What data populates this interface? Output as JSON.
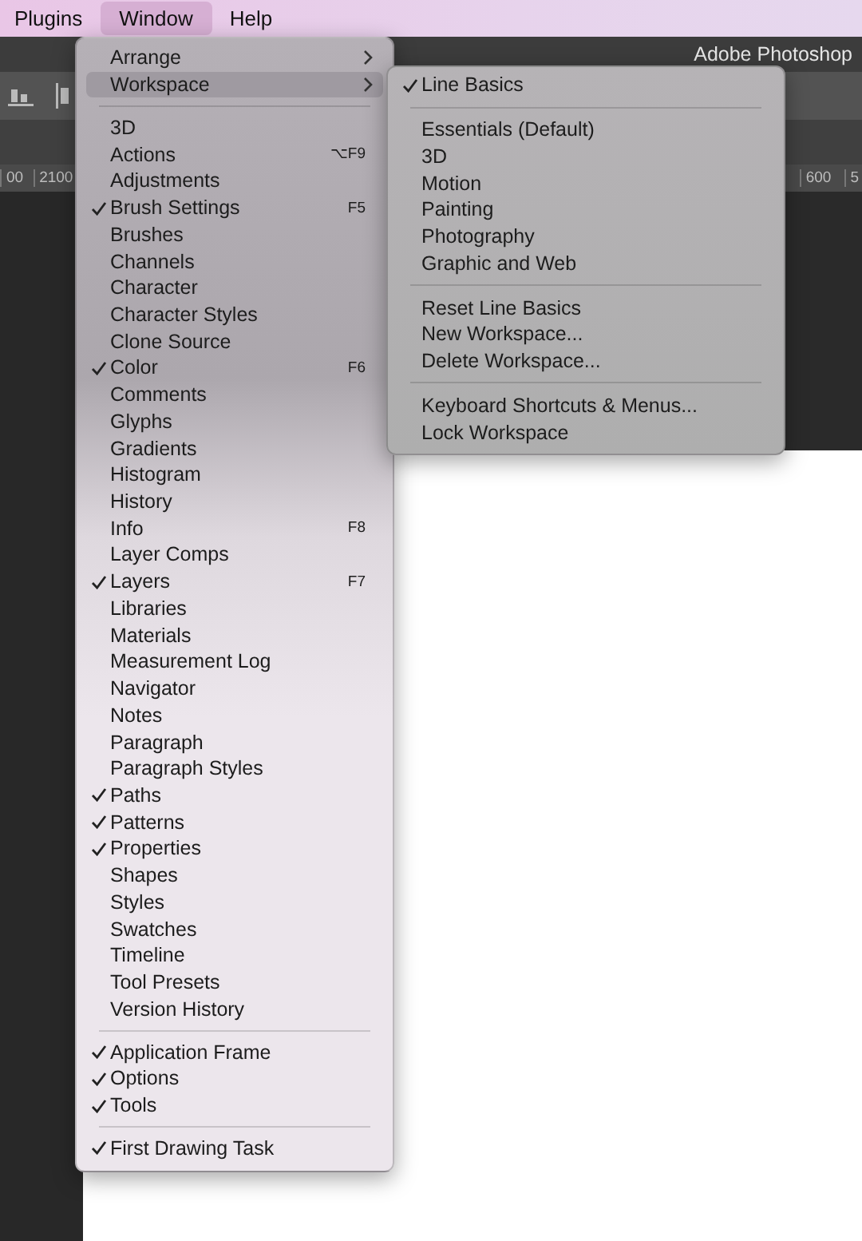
{
  "menu_bar": [
    {
      "label": "Plugins",
      "selected": false
    },
    {
      "label": "Window",
      "selected": true
    },
    {
      "label": "Help",
      "selected": false
    }
  ],
  "app_title": "Adobe Photoshop",
  "ruler": {
    "left_labels": [
      "00",
      "2100"
    ],
    "right_labels": [
      "600",
      "5"
    ]
  },
  "window_menu": {
    "items": [
      {
        "kind": "item",
        "label": "Arrange",
        "checked": false,
        "selected": false,
        "submenu": true
      },
      {
        "kind": "item",
        "label": "Workspace",
        "checked": false,
        "selected": true,
        "submenu": true
      },
      {
        "kind": "separator"
      },
      {
        "kind": "item",
        "label": "3D",
        "checked": false,
        "selected": false,
        "submenu": false
      },
      {
        "kind": "item",
        "label": "Actions",
        "checked": false,
        "selected": false,
        "submenu": false,
        "shortcut": "⌥F9"
      },
      {
        "kind": "item",
        "label": "Adjustments",
        "checked": false,
        "selected": false,
        "submenu": false
      },
      {
        "kind": "item",
        "label": "Brush Settings",
        "checked": true,
        "selected": false,
        "submenu": false,
        "shortcut": "F5"
      },
      {
        "kind": "item",
        "label": "Brushes",
        "checked": false,
        "selected": false,
        "submenu": false
      },
      {
        "kind": "item",
        "label": "Channels",
        "checked": false,
        "selected": false,
        "submenu": false
      },
      {
        "kind": "item",
        "label": "Character",
        "checked": false,
        "selected": false,
        "submenu": false
      },
      {
        "kind": "item",
        "label": "Character Styles",
        "checked": false,
        "selected": false,
        "submenu": false
      },
      {
        "kind": "item",
        "label": "Clone Source",
        "checked": false,
        "selected": false,
        "submenu": false
      },
      {
        "kind": "item",
        "label": "Color",
        "checked": true,
        "selected": false,
        "submenu": false,
        "shortcut": "F6"
      },
      {
        "kind": "item",
        "label": "Comments",
        "checked": false,
        "selected": false,
        "submenu": false
      },
      {
        "kind": "item",
        "label": "Glyphs",
        "checked": false,
        "selected": false,
        "submenu": false
      },
      {
        "kind": "item",
        "label": "Gradients",
        "checked": false,
        "selected": false,
        "submenu": false
      },
      {
        "kind": "item",
        "label": "Histogram",
        "checked": false,
        "selected": false,
        "submenu": false
      },
      {
        "kind": "item",
        "label": "History",
        "checked": false,
        "selected": false,
        "submenu": false
      },
      {
        "kind": "item",
        "label": "Info",
        "checked": false,
        "selected": false,
        "submenu": false,
        "shortcut": "F8"
      },
      {
        "kind": "item",
        "label": "Layer Comps",
        "checked": false,
        "selected": false,
        "submenu": false
      },
      {
        "kind": "item",
        "label": "Layers",
        "checked": true,
        "selected": false,
        "submenu": false,
        "shortcut": "F7"
      },
      {
        "kind": "item",
        "label": "Libraries",
        "checked": false,
        "selected": false,
        "submenu": false
      },
      {
        "kind": "item",
        "label": "Materials",
        "checked": false,
        "selected": false,
        "submenu": false
      },
      {
        "kind": "item",
        "label": "Measurement Log",
        "checked": false,
        "selected": false,
        "submenu": false
      },
      {
        "kind": "item",
        "label": "Navigator",
        "checked": false,
        "selected": false,
        "submenu": false
      },
      {
        "kind": "item",
        "label": "Notes",
        "checked": false,
        "selected": false,
        "submenu": false
      },
      {
        "kind": "item",
        "label": "Paragraph",
        "checked": false,
        "selected": false,
        "submenu": false
      },
      {
        "kind": "item",
        "label": "Paragraph Styles",
        "checked": false,
        "selected": false,
        "submenu": false
      },
      {
        "kind": "item",
        "label": "Paths",
        "checked": true,
        "selected": false,
        "submenu": false
      },
      {
        "kind": "item",
        "label": "Patterns",
        "checked": true,
        "selected": false,
        "submenu": false
      },
      {
        "kind": "item",
        "label": "Properties",
        "checked": true,
        "selected": false,
        "submenu": false
      },
      {
        "kind": "item",
        "label": "Shapes",
        "checked": false,
        "selected": false,
        "submenu": false
      },
      {
        "kind": "item",
        "label": "Styles",
        "checked": false,
        "selected": false,
        "submenu": false
      },
      {
        "kind": "item",
        "label": "Swatches",
        "checked": false,
        "selected": false,
        "submenu": false
      },
      {
        "kind": "item",
        "label": "Timeline",
        "checked": false,
        "selected": false,
        "submenu": false
      },
      {
        "kind": "item",
        "label": "Tool Presets",
        "checked": false,
        "selected": false,
        "submenu": false
      },
      {
        "kind": "item",
        "label": "Version History",
        "checked": false,
        "selected": false,
        "submenu": false
      },
      {
        "kind": "separator"
      },
      {
        "kind": "item",
        "label": "Application Frame",
        "checked": true,
        "selected": false,
        "submenu": false
      },
      {
        "kind": "item",
        "label": "Options",
        "checked": true,
        "selected": false,
        "submenu": false
      },
      {
        "kind": "item",
        "label": "Tools",
        "checked": true,
        "selected": false,
        "submenu": false
      },
      {
        "kind": "separator"
      },
      {
        "kind": "item",
        "label": "First  Drawing Task",
        "checked": true,
        "selected": false,
        "submenu": false
      }
    ]
  },
  "workspace_submenu": {
    "items": [
      {
        "kind": "item",
        "label": "Line Basics",
        "checked": true
      },
      {
        "kind": "separator"
      },
      {
        "kind": "item",
        "label": "Essentials (Default)",
        "checked": false
      },
      {
        "kind": "item",
        "label": "3D",
        "checked": false
      },
      {
        "kind": "item",
        "label": "Motion",
        "checked": false
      },
      {
        "kind": "item",
        "label": "Painting",
        "checked": false
      },
      {
        "kind": "item",
        "label": "Photography",
        "checked": false
      },
      {
        "kind": "item",
        "label": "Graphic and Web",
        "checked": false
      },
      {
        "kind": "separator"
      },
      {
        "kind": "item",
        "label": "Reset Line Basics",
        "checked": false
      },
      {
        "kind": "item",
        "label": "New Workspace...",
        "checked": false
      },
      {
        "kind": "item",
        "label": "Delete Workspace...",
        "checked": false
      },
      {
        "kind": "separator"
      },
      {
        "kind": "item",
        "label": "Keyboard Shortcuts & Menus...",
        "checked": false
      },
      {
        "kind": "item",
        "label": "Lock Workspace",
        "checked": false
      }
    ]
  }
}
